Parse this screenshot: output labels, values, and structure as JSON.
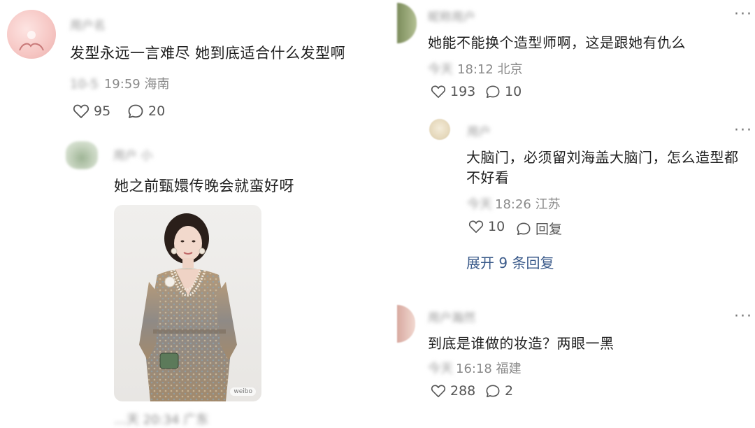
{
  "left": {
    "comment1": {
      "username": "用户名",
      "text": "发型永远一言难尽 她到底适合什么发型啊",
      "date": "10-5",
      "time_location": "19:59 海南",
      "likes": "95",
      "replies": "20"
    },
    "reply1": {
      "username": "用户 小",
      "text": "她之前甄嬛传晚会就蛮好呀",
      "photo_badge": "weibo",
      "bottom_meta": "…天 20:34 广东"
    }
  },
  "right": {
    "comment2": {
      "username": "昵称用户",
      "text": "她能不能换个造型师啊，这是跟她有仇么",
      "date": "今天",
      "time_location": "18:12 北京",
      "likes": "193",
      "replies": "10"
    },
    "reply2": {
      "username": "用户",
      "text_line1": "大脑门，必须留刘海盖大脑门，怎么造型都",
      "text_line2": "不好看",
      "date": "今天",
      "time_location": "18:26 江苏",
      "likes": "10",
      "reply_label": "回复",
      "expand_label": "展开 9 条回复"
    },
    "comment3": {
      "username": "用户瀚然",
      "text": "到底是谁做的妆造？两眼一黑",
      "date": "今天",
      "time_location": "16:18 福建",
      "likes": "288",
      "replies": "2"
    }
  },
  "icons": {
    "like": "heart-outline-icon",
    "comment": "speech-bubble-icon",
    "more": "more-dots-icon"
  },
  "colors": {
    "link": "#3a5a8a",
    "meta": "#8a8a8a"
  }
}
